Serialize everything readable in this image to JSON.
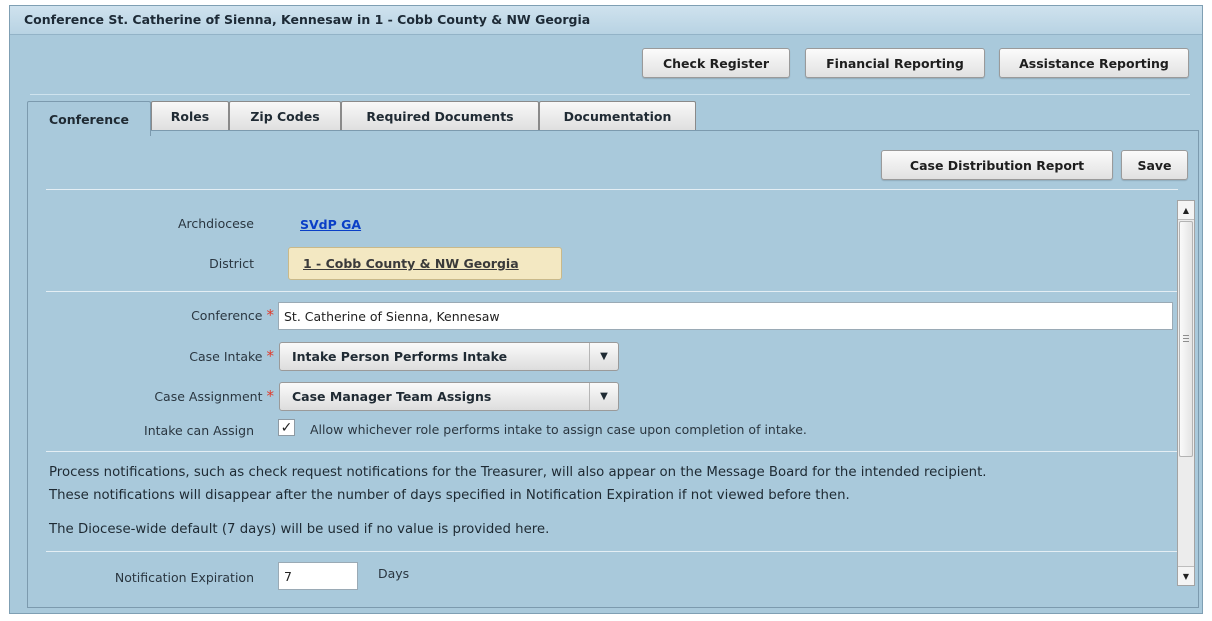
{
  "window": {
    "title": "Conference St. Catherine of Sienna, Kennesaw in 1 - Cobb County & NW Georgia"
  },
  "toolbar": {
    "check_register": "Check Register",
    "financial_reporting": "Financial Reporting",
    "assistance_reporting": "Assistance Reporting"
  },
  "tabs": {
    "conference": "Conference",
    "roles": "Roles",
    "zip_codes": "Zip Codes",
    "required_documents": "Required Documents",
    "documentation": "Documentation",
    "active": "Conference"
  },
  "panel_actions": {
    "case_distribution_report": "Case Distribution Report",
    "save": "Save"
  },
  "form": {
    "archdiocese_label": "Archdiocese",
    "archdiocese_value": "SVdP GA",
    "district_label": "District",
    "district_value": "1 - Cobb County & NW Georgia",
    "conference_label": "Conference",
    "conference_value": "St. Catherine of Sienna, Kennesaw",
    "case_intake_label": "Case Intake",
    "case_intake_value": "Intake Person Performs Intake",
    "case_assignment_label": "Case Assignment",
    "case_assignment_value": "Case Manager Team Assigns",
    "intake_can_assign_label": "Intake can Assign",
    "intake_can_assign_checked": true,
    "intake_can_assign_text": "Allow whichever role performs intake to assign case upon completion of intake.",
    "required_marker": "*"
  },
  "notifications": {
    "line1": "Process notifications, such as check request notifications for the Treasurer, will also appear on the Message Board for the intended recipient.",
    "line2": "These notifications will disappear after the number of days specified in Notification Expiration if not viewed before then.",
    "line3": "The Diocese-wide default (7 days) will be used if no value is provided here.",
    "expiration_label": "Notification Expiration",
    "expiration_value": "7",
    "expiration_unit": "Days"
  },
  "icons": {
    "checkmark": "check-icon",
    "dropdown": "chevron-down-icon",
    "scroll_up": "scroll-up-icon",
    "scroll_down": "scroll-down-icon"
  },
  "colors": {
    "panel_background": "#a9c9db",
    "link": "#0a3fc7",
    "district_background": "#f3e8c2",
    "required": "#e03a2a"
  }
}
